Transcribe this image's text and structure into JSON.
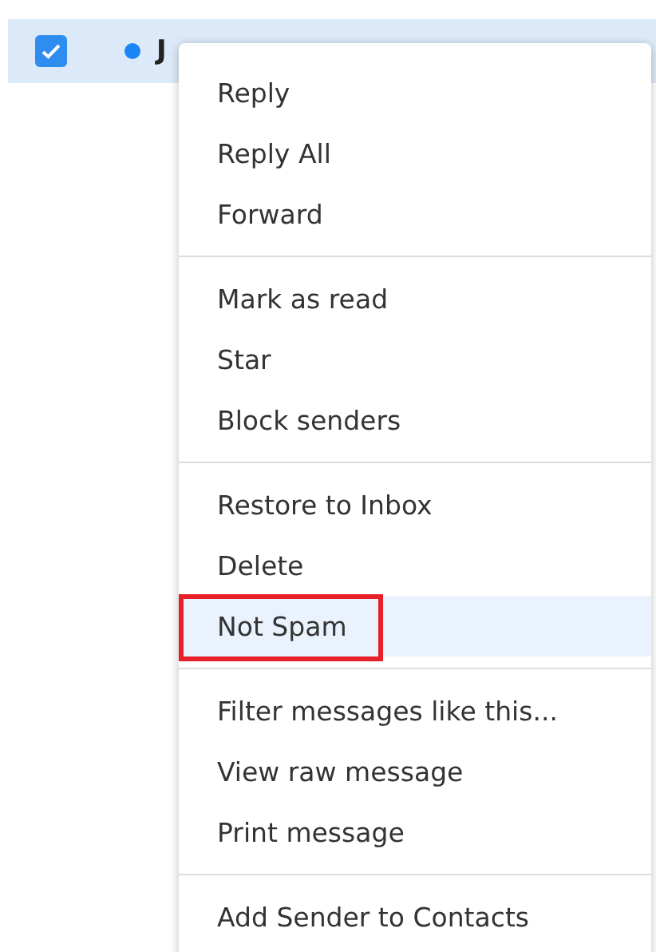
{
  "message_row": {
    "checked": true,
    "unread": true,
    "sender_fragments": [
      "J"
    ]
  },
  "context_menu": {
    "groups": [
      {
        "items": [
          {
            "label": "Reply",
            "selected": false,
            "annotated": false
          },
          {
            "label": "Reply All",
            "selected": false,
            "annotated": false
          },
          {
            "label": "Forward",
            "selected": false,
            "annotated": false
          }
        ]
      },
      {
        "items": [
          {
            "label": "Mark as read",
            "selected": false,
            "annotated": false
          },
          {
            "label": "Star",
            "selected": false,
            "annotated": false
          },
          {
            "label": "Block senders",
            "selected": false,
            "annotated": false
          }
        ]
      },
      {
        "items": [
          {
            "label": "Restore to Inbox",
            "selected": false,
            "annotated": false
          },
          {
            "label": "Delete",
            "selected": false,
            "annotated": false
          },
          {
            "label": "Not Spam",
            "selected": true,
            "annotated": true
          }
        ]
      },
      {
        "items": [
          {
            "label": "Filter messages like this...",
            "selected": false,
            "annotated": false
          },
          {
            "label": "View raw message",
            "selected": false,
            "annotated": false
          },
          {
            "label": "Print message",
            "selected": false,
            "annotated": false
          }
        ]
      },
      {
        "items": [
          {
            "label": "Add Sender to Contacts",
            "selected": false,
            "annotated": false
          }
        ]
      }
    ]
  }
}
